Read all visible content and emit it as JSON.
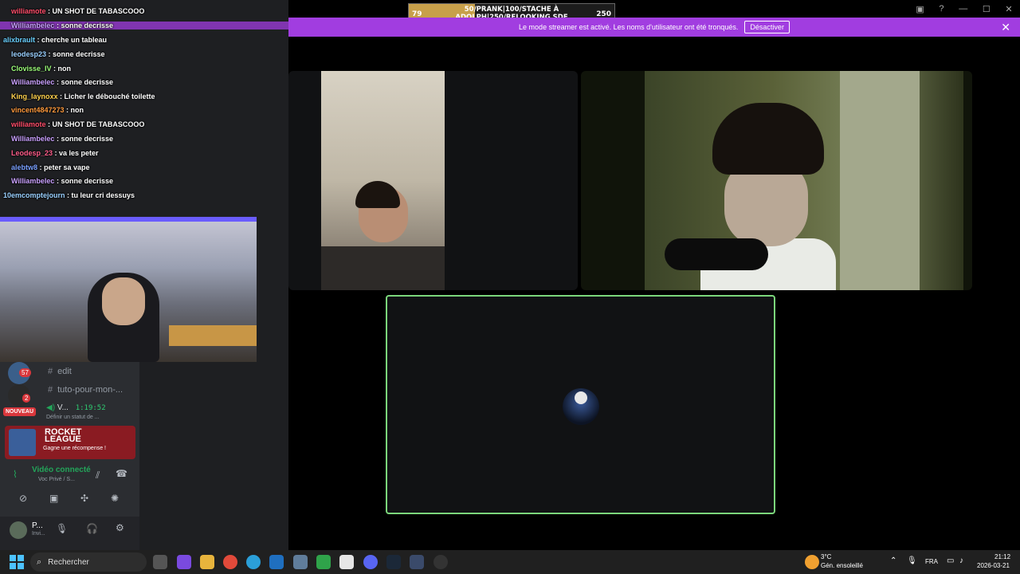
{
  "banner": {
    "message": "Le mode streamer est activé. Les noms d'utilisateur ont été tronqués.",
    "button_label": "Désactiver",
    "close": "✕"
  },
  "goal": {
    "current": "79",
    "target": "250",
    "text_line1": "50/PRANK|100/STACHE À",
    "text_line2": "ADOLPH|250/RELOOKING SDF",
    "progress_fraction": 0.32
  },
  "chat": [
    {
      "user": "williamote",
      "text": " : UN SHOT DE TABASCOOO",
      "color": "#ff4d6a",
      "hl": false
    },
    {
      "user": "Williambelec",
      "text": " : sonne decrisse",
      "color": "#c9a0ff",
      "hl": true
    },
    {
      "user": "alixbrault",
      "text": " : cherche un tableau",
      "color": "#6ad1ff",
      "hl": false
    },
    {
      "user": "leodesp23",
      "text": " : sonne decrisse",
      "color": "#9ad0ff",
      "hl": false
    },
    {
      "user": "Clovisse_IV",
      "text": " : non",
      "color": "#9dff7a",
      "hl": false
    },
    {
      "user": "Williambelec",
      "text": " : sonne decrisse",
      "color": "#c9a0ff",
      "hl": false
    },
    {
      "user": "King_laynoxx",
      "text": " : Licher le débouché toilette",
      "color": "#ffd24d",
      "hl": false
    },
    {
      "user": "vincent4847273",
      "text": " : non",
      "color": "#ff9a3c",
      "hl": false
    },
    {
      "user": "williamote",
      "text": " : UN SHOT DE TABASCOOO",
      "color": "#ff4d6a",
      "hl": false
    },
    {
      "user": "Williambelec",
      "text": " : sonne decrisse",
      "color": "#c9a0ff",
      "hl": false
    },
    {
      "user": "Leodesp_23",
      "text": " : va les peter",
      "color": "#ff5c8a",
      "hl": false
    },
    {
      "user": "alebtw8",
      "text": " : peter sa vape",
      "color": "#7aa0ff",
      "hl": false
    },
    {
      "user": "Williambelec",
      "text": " : sonne decrisse",
      "color": "#c9a0ff",
      "hl": false
    },
    {
      "user": "10emcomptejourn",
      "text": " : tu leur cri dessuys",
      "color": "#9ad0ff",
      "hl": false
    }
  ],
  "sidebar": {
    "channels": [
      {
        "label": "edit"
      },
      {
        "label": "tuto-pour-mon-..."
      }
    ],
    "badge_counts": [
      "57",
      "2"
    ],
    "nouveau": "NOUVEAU",
    "voice_user": "V...",
    "voice_time": "1:19:52",
    "voice_status": "Définir un statut de ...",
    "promo_logo_line1": "ROCKET",
    "promo_logo_line2": "LEAGUE",
    "promo_reward": "Gagne une récompense !",
    "video_connected": "Vidéo connecté",
    "voice_channel": "Voc Privé / S...",
    "user_name": "P...",
    "user_status": "Invi..."
  },
  "taskbar": {
    "search_placeholder": "Rechercher",
    "weather_temp": "3°C",
    "weather_desc": "Gén. ensoleillé",
    "lang": "FRA",
    "time": "21:12",
    "date": "2026-03-21"
  },
  "colors": {
    "banner": "#a13de0",
    "speaking_border": "#7bd67b",
    "discord_green": "#23a55a"
  }
}
